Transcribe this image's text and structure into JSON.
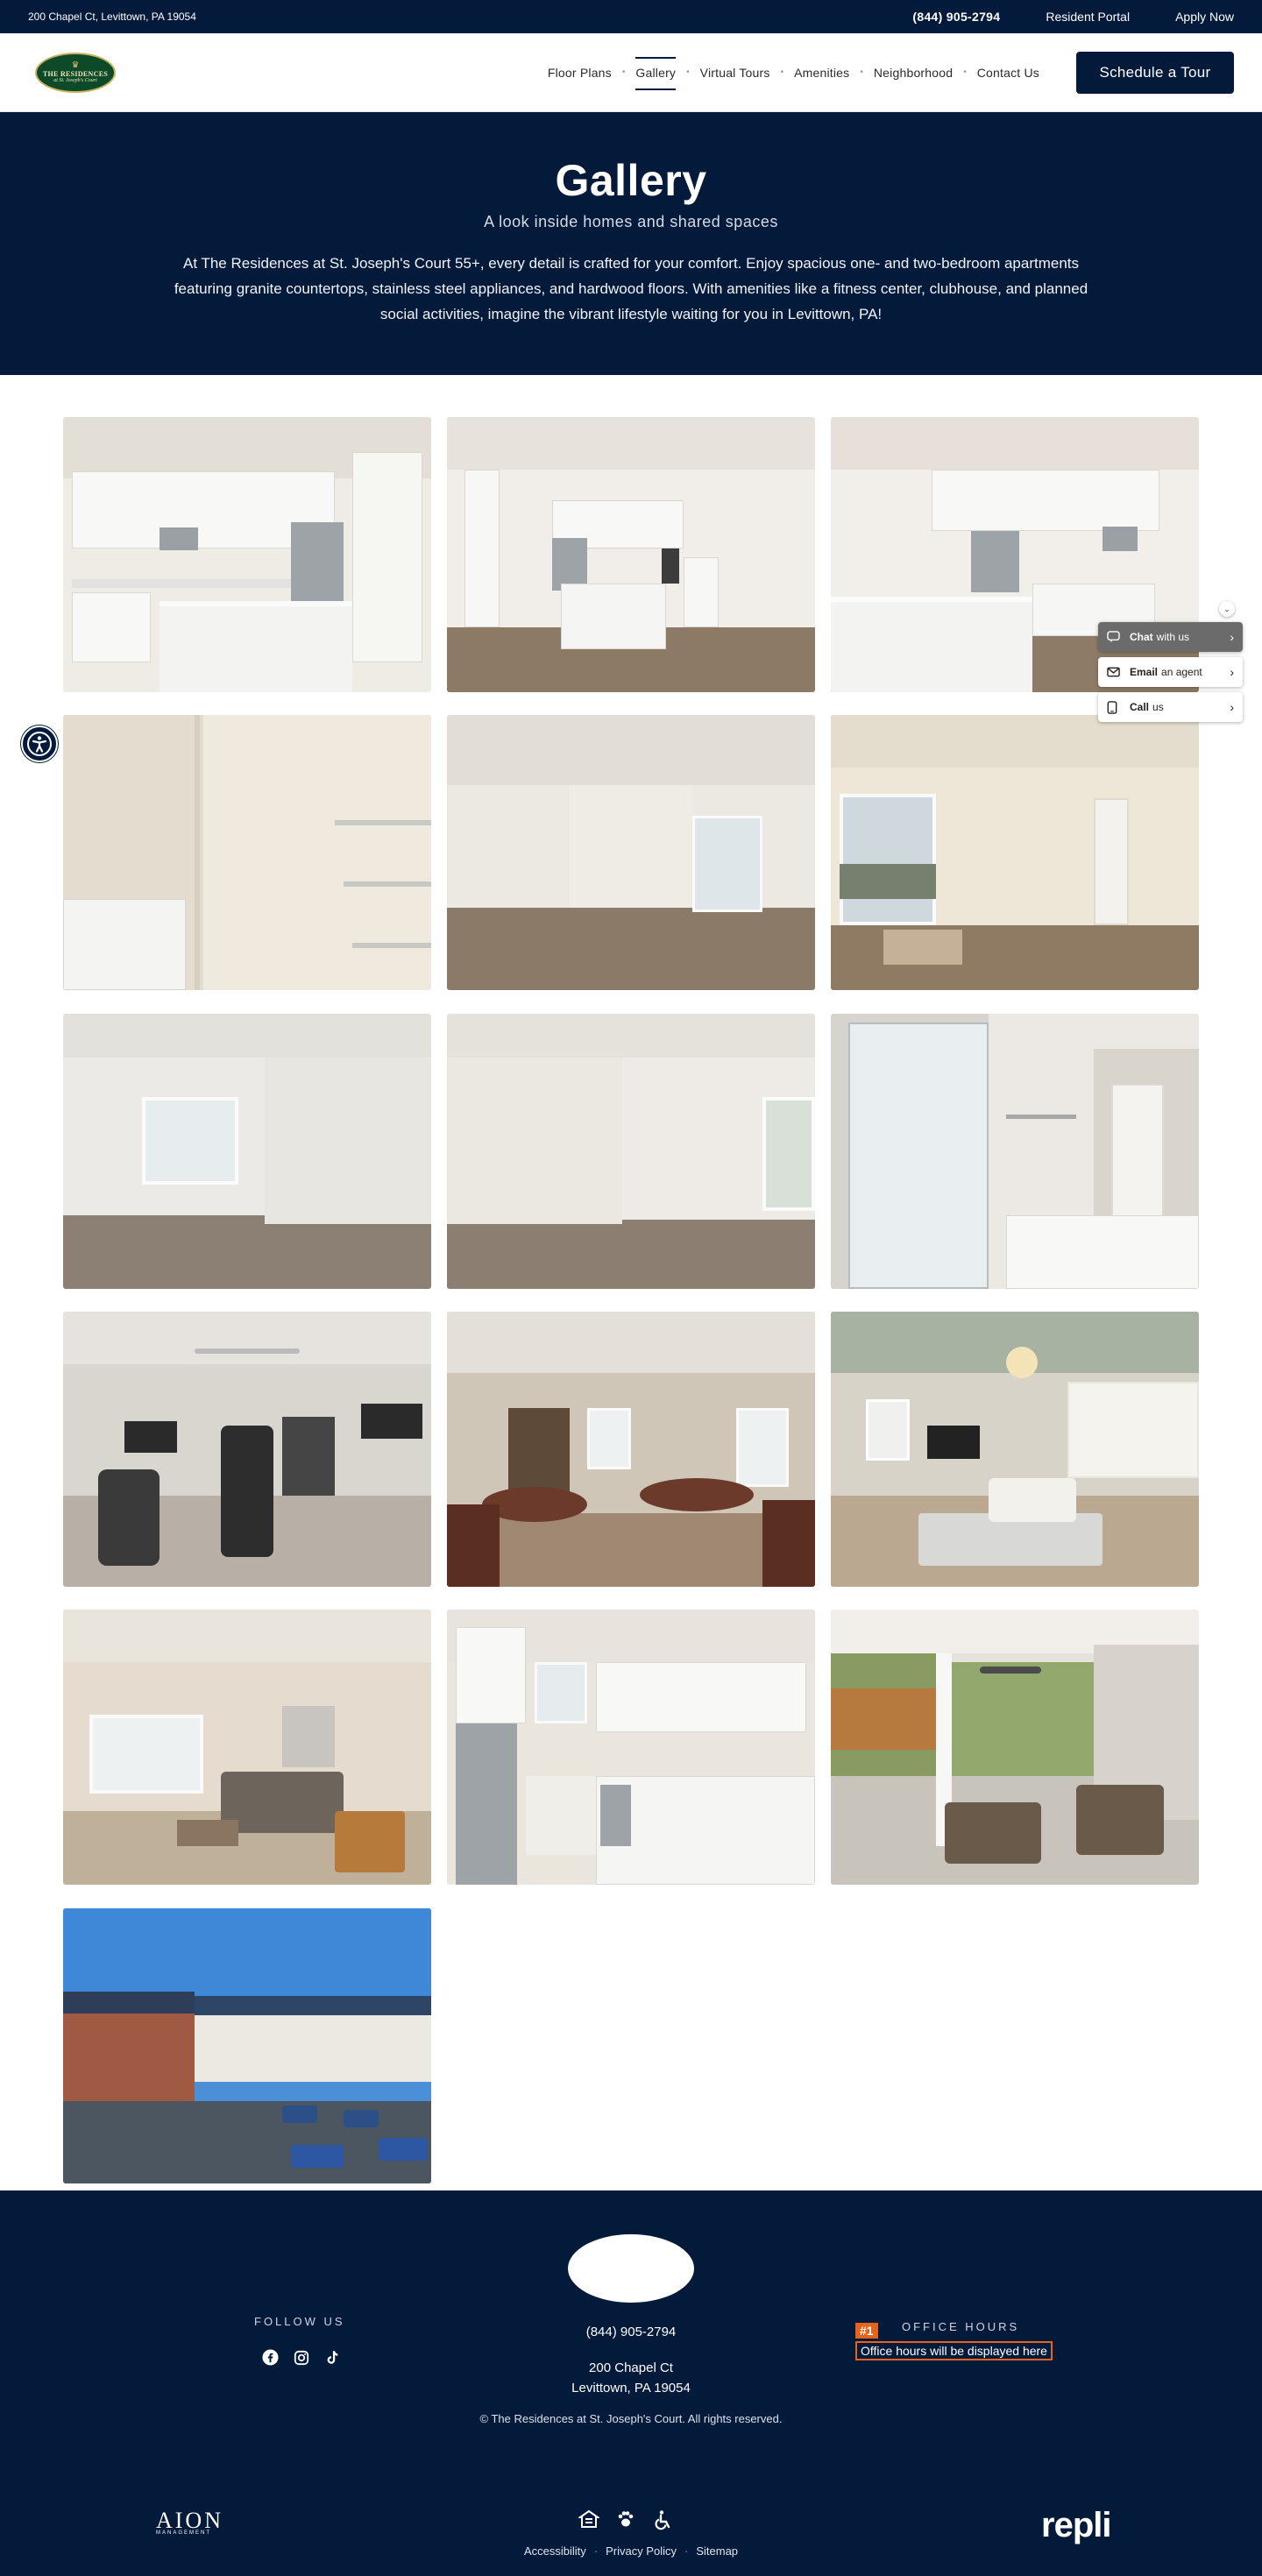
{
  "topbar": {
    "address": "200 Chapel Ct, Levittown, PA 19054",
    "phone": "(844) 905-2794",
    "resident_portal": "Resident Portal",
    "apply_now": "Apply Now"
  },
  "logo": {
    "line1": "THE RESIDENCES",
    "line2": "at St. Joseph's Court"
  },
  "nav": {
    "items": [
      {
        "label": "Floor Plans"
      },
      {
        "label": "Gallery"
      },
      {
        "label": "Virtual Tours"
      },
      {
        "label": "Amenities"
      },
      {
        "label": "Neighborhood"
      },
      {
        "label": "Contact Us"
      }
    ],
    "separator": "•",
    "active": "Gallery",
    "cta": "Schedule a Tour"
  },
  "hero": {
    "title": "Gallery",
    "subtitle": "A look inside homes and shared spaces",
    "intro": "At The Residences at St. Joseph's Court 55+, every detail is crafted for your comfort. Enjoy spacious one- and two-bedroom apartments featuring granite countertops, stainless steel appliances, and hardwood floors. With amenities like a fitness center, clubhouse, and planned social activities, imagine the vibrant lifestyle waiting for you in Levittown, PA!"
  },
  "gallery": {
    "photos": [
      {
        "scene": "kitchen"
      },
      {
        "scene": "kitchen-wide"
      },
      {
        "scene": "kitchen-island"
      },
      {
        "scene": "laundry-closet"
      },
      {
        "scene": "living-room"
      },
      {
        "scene": "living-room-patio-door"
      },
      {
        "scene": "bedroom"
      },
      {
        "scene": "bedroom-corner"
      },
      {
        "scene": "bathroom"
      },
      {
        "scene": "fitness-center"
      },
      {
        "scene": "game-room"
      },
      {
        "scene": "clubhouse-lounge"
      },
      {
        "scene": "clubhouse-seating"
      },
      {
        "scene": "clubhouse-kitchen"
      },
      {
        "scene": "covered-patio"
      },
      {
        "scene": "building-exterior"
      }
    ]
  },
  "widgets": {
    "chat": {
      "bold": "Chat",
      "rest": "with us"
    },
    "email": {
      "bold": "Email",
      "rest": "an agent"
    },
    "call": {
      "bold": "Call",
      "rest": "us"
    }
  },
  "footer": {
    "follow_us": "FOLLOW US",
    "phone": "(844) 905-2794",
    "address_line1": "200 Chapel Ct",
    "address_line2": "Levittown, PA 19054",
    "copyright": "© The Residences at St. Joseph's Court. All rights reserved.",
    "office_hours_title": "OFFICE HOURS",
    "office_hours_badge": "#1",
    "office_hours_text": "Office hours will be displayed here",
    "management": "AION",
    "management_sub": "MANAGEMENT",
    "links": {
      "accessibility": "Accessibility",
      "privacy": "Privacy Policy",
      "sitemap": "Sitemap"
    },
    "link_separator": "·",
    "powered_by": "repli"
  },
  "colors": {
    "navy": "#031a3a",
    "accent": "#e3641a",
    "logo_green": "#0c4a2a"
  }
}
